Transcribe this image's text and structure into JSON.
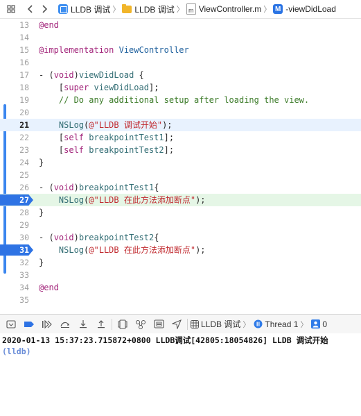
{
  "jumpbar": {
    "back_icon": "chevron-left-icon",
    "forward_icon": "chevron-right-icon",
    "crumbs": [
      "LLDB 调试",
      "LLDB 调试",
      "ViewController.m",
      "-viewDidLoad"
    ],
    "file_badge": "m",
    "method_badge": "M"
  },
  "editor": {
    "lines": [
      {
        "n": "13",
        "t": "@end"
      },
      {
        "n": "14",
        "t": ""
      },
      {
        "n": "15",
        "t": "@implementation ViewController"
      },
      {
        "n": "16",
        "t": ""
      },
      {
        "n": "17",
        "t": "- (void)viewDidLoad {"
      },
      {
        "n": "18",
        "t": "    [super viewDidLoad];"
      },
      {
        "n": "19",
        "t": "    // Do any additional setup after loading the view."
      },
      {
        "n": "20",
        "t": ""
      },
      {
        "n": "21",
        "t": "    NSLog(@\"LLDB 调试开始\");"
      },
      {
        "n": "22",
        "t": "    [self breakpointTest1];"
      },
      {
        "n": "23",
        "t": "    [self breakpointTest2];"
      },
      {
        "n": "24",
        "t": "}"
      },
      {
        "n": "25",
        "t": ""
      },
      {
        "n": "26",
        "t": "- (void)breakpointTest1{"
      },
      {
        "n": "27",
        "t": "    NSLog(@\"LLDB 在此方法添加断点\");"
      },
      {
        "n": "28",
        "t": "}"
      },
      {
        "n": "29",
        "t": ""
      },
      {
        "n": "30",
        "t": "- (void)breakpointTest2{"
      },
      {
        "n": "31",
        "t": "    NSLog(@\"LLDB 在此方法添加断点\");"
      },
      {
        "n": "32",
        "t": "}"
      },
      {
        "n": "33",
        "t": ""
      },
      {
        "n": "34",
        "t": "@end"
      },
      {
        "n": "35",
        "t": ""
      }
    ],
    "current_line": "21",
    "breakpoint_lines": [
      "27",
      "31"
    ],
    "colors": {
      "breakpoint": "#2e73e4",
      "current_line_bg": "#e8f2fe",
      "stopped_line_bg": "#e5f6e6"
    }
  },
  "debugbar": {
    "crumbs": [
      "LLDB 调试",
      "Thread 1",
      "0"
    ],
    "icons": [
      "toggle-console-icon",
      "breakpoint-toggle-icon",
      "continue-icon",
      "step-over-icon",
      "step-into-icon",
      "step-out-icon",
      "view-hierarchy-icon",
      "memory-graph-icon",
      "environment-icon",
      "location-icon"
    ]
  },
  "console": {
    "log_line": "2020-01-13 15:37:23.715872+0800 LLDB调试[42805:18054826] LLDB 调试开始",
    "prompt": "(lldb)"
  }
}
